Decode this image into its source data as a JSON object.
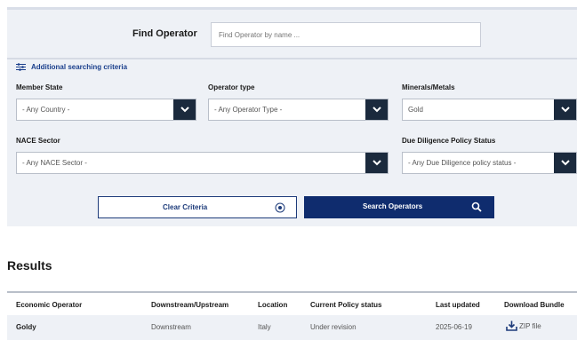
{
  "search": {
    "find_label": "Find Operator",
    "find_placeholder": "Find Operator by name ...",
    "advanced_label": "Additional searching criteria",
    "member_state": {
      "label": "Member State",
      "value": "- Any Country -"
    },
    "operator_type": {
      "label": "Operator type",
      "value": "- Any Operator Type -"
    },
    "minerals": {
      "label": "Minerals/Metals",
      "value": "Gold"
    },
    "nace": {
      "label": "NACE Sector",
      "value": "- Any NACE Sector -"
    },
    "due_diligence": {
      "label": "Due Diligence Policy Status",
      "value": "- Any Due Diligence policy status -"
    },
    "clear_label": "Clear Criteria",
    "search_label": "Search Operators"
  },
  "results": {
    "title": "Results",
    "columns": [
      "Economic Operator",
      "Downstream/Upstream",
      "Location",
      "Current Policy status",
      "Last updated",
      "Download Bundle"
    ],
    "rows": [
      {
        "operator": "Goldy",
        "stream": "Downstream",
        "location": "Italy",
        "status": "Under revision",
        "updated": "2025-06-19",
        "download": "ZIP file"
      }
    ]
  },
  "colors": {
    "panel_bg": "#eef1f6",
    "primary": "#0f2c6e",
    "arrow_bg": "#1b2a3d",
    "link": "#1d3b7a"
  }
}
